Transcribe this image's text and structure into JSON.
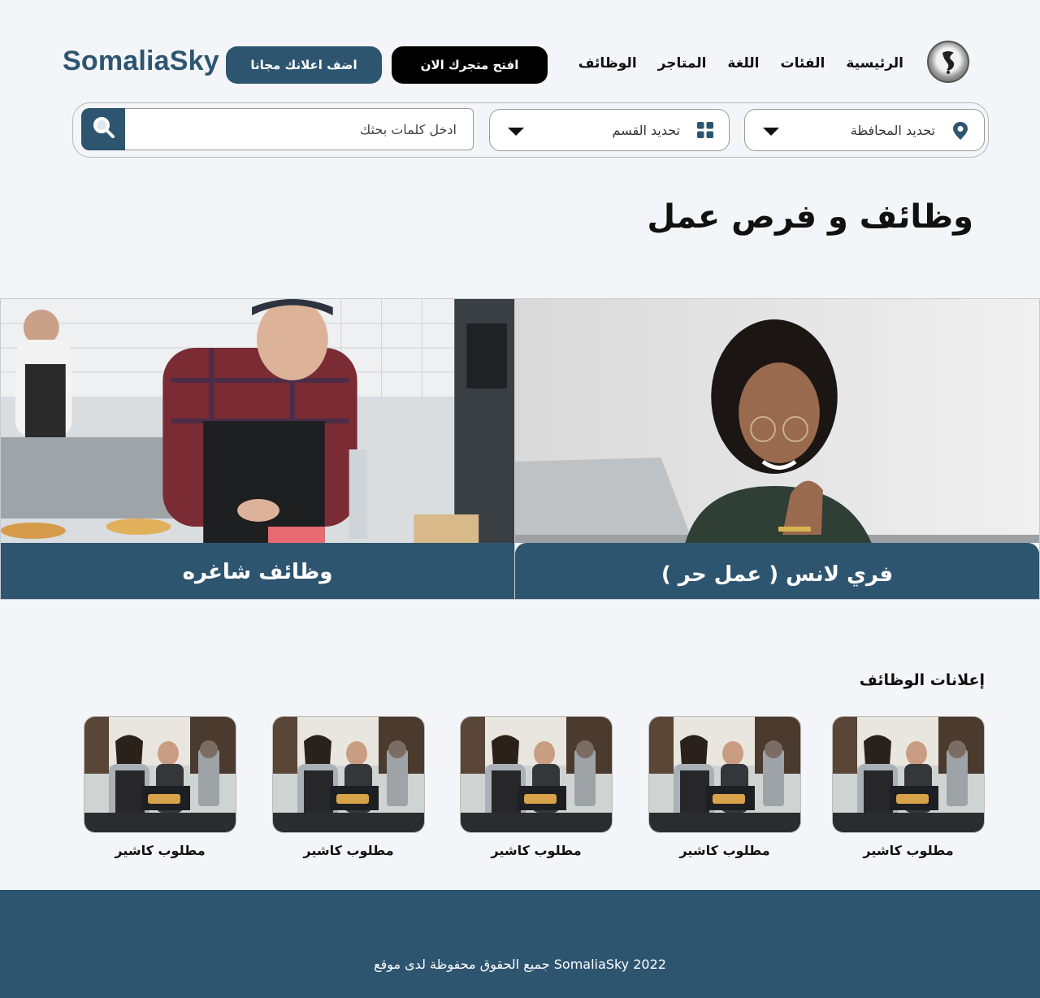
{
  "header": {
    "brand": "SomaliaSky",
    "add_ad_label": "اضف اعلانك مجانا",
    "open_store_label": "افتح متجرك الان",
    "nav": [
      {
        "label": "الرئيسية"
      },
      {
        "label": "الفئات"
      },
      {
        "label": "اللغة"
      },
      {
        "label": "المتاجر"
      },
      {
        "label": "الوظائف"
      }
    ]
  },
  "search": {
    "governorate_label": "تحديد المحافظة",
    "category_label": "تحديد القسم",
    "keyword_placeholder": "ادخل كلمات بحثك"
  },
  "main": {
    "title": "وظائف و فرص عمل",
    "banners": {
      "freelance": "فري لانس ( عمل حر )",
      "vacant_jobs": "وظائف شاغره"
    },
    "ads_title": "إعلانات الوظائف",
    "ads": [
      {
        "label": "مطلوب كاشير"
      },
      {
        "label": "مطلوب كاشير"
      },
      {
        "label": "مطلوب كاشير"
      },
      {
        "label": "مطلوب كاشير"
      },
      {
        "label": "مطلوب كاشير"
      }
    ]
  },
  "footer": {
    "copyright": "SomaliaSky 2022 جميع الحقوق محفوظة لدى موقع"
  },
  "colors": {
    "primary": "#2e5570",
    "background": "#f4f5f8",
    "dark_button": "#000000"
  }
}
